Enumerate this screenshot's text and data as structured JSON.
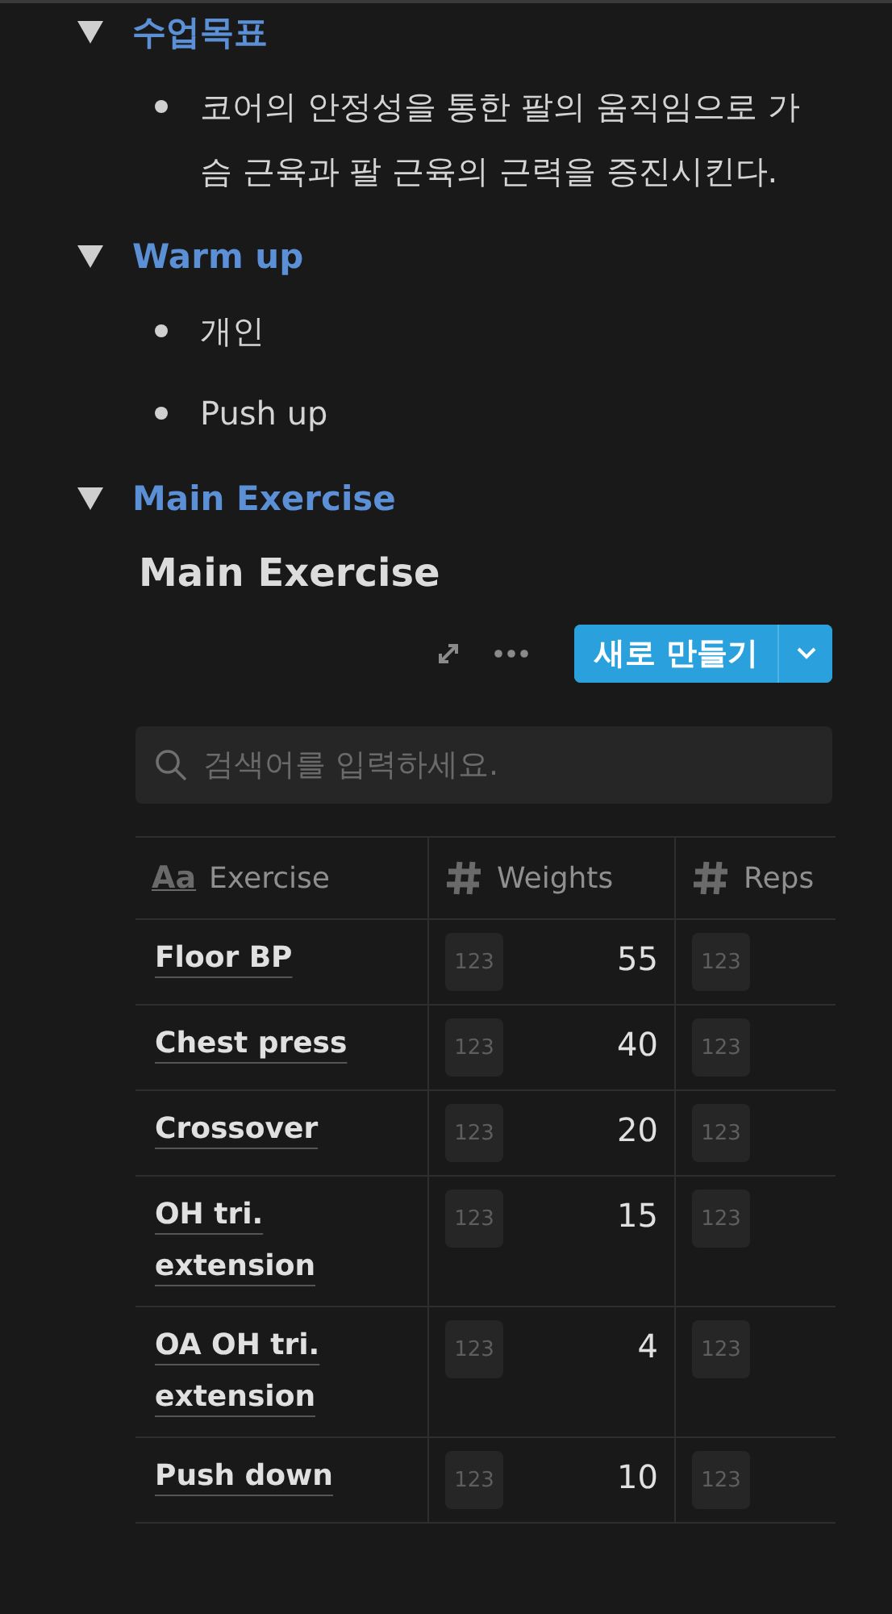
{
  "sections": [
    {
      "title": "수업목표",
      "expanded": true,
      "bullets": [
        "코어의 안정성을 통한 팔의 움직임으로 가슴 근육과 팔 근육의 근력을 증진시킨다."
      ]
    },
    {
      "title": "Warm up",
      "expanded": true,
      "bullets": [
        "개인",
        "Push up"
      ]
    },
    {
      "title": "Main Exercise",
      "expanded": true,
      "database": {
        "title": "Main Exercise",
        "new_button": "새로 만들기",
        "search": {
          "placeholder": "검색어를 입력하세요."
        },
        "columns": [
          {
            "kind": "title",
            "icon_text": "Aa",
            "label": "Exercise"
          },
          {
            "kind": "number",
            "label": "Weights"
          },
          {
            "kind": "number",
            "label": "Reps"
          }
        ],
        "rows": [
          {
            "cells": [
              "Floor BP",
              {
                "badge": "123",
                "value": "55"
              },
              {
                "badge": "123"
              }
            ]
          },
          {
            "cells": [
              "Chest press",
              {
                "badge": "123",
                "value": "40"
              },
              {
                "badge": "123"
              }
            ]
          },
          {
            "cells": [
              "Crossover",
              {
                "badge": "123",
                "value": "20"
              },
              {
                "badge": "123"
              }
            ]
          },
          {
            "cells": [
              "OH tri. extension",
              {
                "badge": "123",
                "value": "15"
              },
              {
                "badge": "123"
              }
            ]
          },
          {
            "cells": [
              "OA OH tri. extension",
              {
                "badge": "123",
                "value": "4"
              },
              {
                "badge": "123"
              }
            ]
          },
          {
            "cells": [
              "Push down",
              {
                "badge": "123",
                "value": "10"
              },
              {
                "badge": "123"
              }
            ]
          }
        ]
      }
    }
  ]
}
